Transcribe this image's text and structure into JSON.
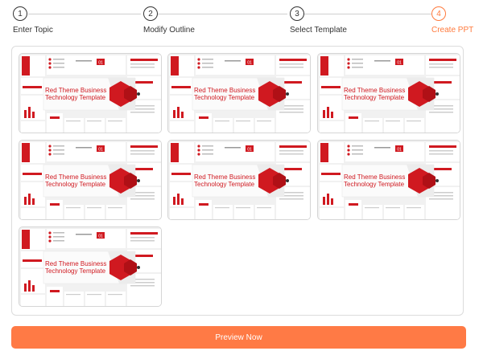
{
  "steps": [
    {
      "number": "1",
      "label": "Enter Topic",
      "active": false
    },
    {
      "number": "2",
      "label": "Modify Outline",
      "active": false
    },
    {
      "number": "3",
      "label": "Select Template",
      "active": false
    },
    {
      "number": "4",
      "label": "Create PPT",
      "active": true
    }
  ],
  "templates": [
    {
      "title_line1": "Red Theme Business",
      "title_line2": "Technology Template",
      "badge": "01"
    },
    {
      "title_line1": "Red Theme Business",
      "title_line2": "Technology Template",
      "badge": "01"
    },
    {
      "title_line1": "Red Theme Business",
      "title_line2": "Technology Template",
      "badge": "01"
    },
    {
      "title_line1": "Red Theme Business",
      "title_line2": "Technology Template",
      "badge": "01"
    },
    {
      "title_line1": "Red Theme Business",
      "title_line2": "Technology Template",
      "badge": "01"
    },
    {
      "title_line1": "Red Theme Business",
      "title_line2": "Technology Template",
      "badge": "01"
    },
    {
      "title_line1": "Red Theme Business",
      "title_line2": "Technology Template",
      "badge": "01"
    }
  ],
  "preview_button": {
    "label": "Preview Now"
  },
  "colors": {
    "accent": "#ff7a45",
    "theme_red": "#d01920"
  }
}
